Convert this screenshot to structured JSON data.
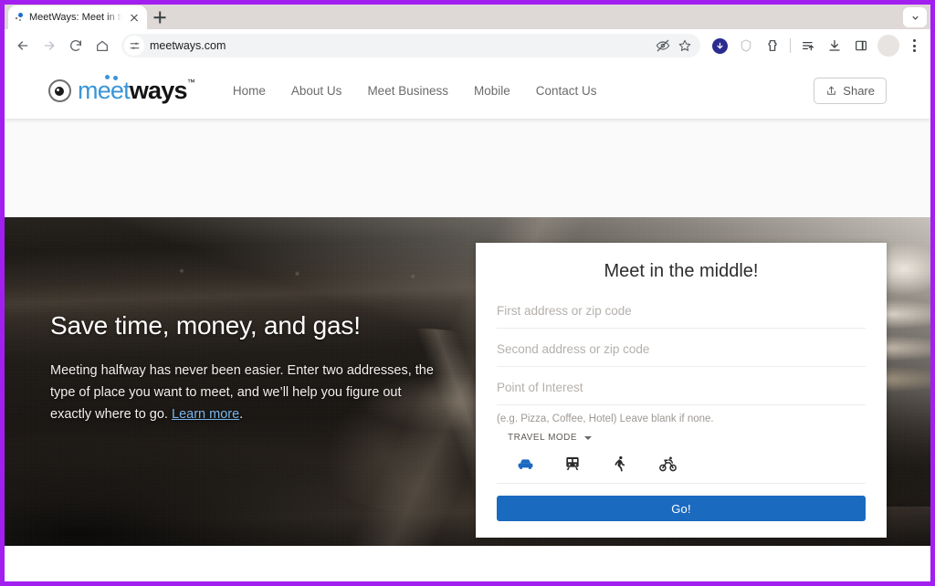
{
  "browser": {
    "tab": {
      "title": "MeetWays: Meet in the Midd",
      "favicon": "meetways-favicon-icon",
      "close": "close-icon"
    },
    "new_tab_label": "new-tab-icon",
    "tabstrip_chevron": "chevron-down-icon",
    "toolbar": {
      "back": "back-arrow-icon",
      "forward": "forward-arrow-icon",
      "reload": "reload-icon",
      "home": "home-icon",
      "site_settings": "tune-sliders-icon",
      "url": "meetways.com",
      "tracking_protection": "eye-off-icon",
      "bookmark": "star-icon",
      "download_alert": "download-notification-badge-icon",
      "shield": "shield-icon",
      "extensions": "extensions-puzzle-icon",
      "reading_list": "reading-list-icon",
      "downloads": "download-icon",
      "side_panel": "side-panel-icon",
      "profile": "avatar",
      "menu": "three-dots-menu-icon"
    }
  },
  "site": {
    "logo": {
      "part_one": "meet",
      "part_two": "ways",
      "trademark": "™"
    },
    "nav": [
      {
        "label": "Home"
      },
      {
        "label": "About Us"
      },
      {
        "label": "Meet Business"
      },
      {
        "label": "Mobile"
      },
      {
        "label": "Contact Us"
      }
    ],
    "share": {
      "label": "Share",
      "icon": "share-upload-icon"
    }
  },
  "hero": {
    "heading": "Save time, money, and gas!",
    "body_before": "Meeting halfway has never been easier. Enter two addresses, the type of place you want to meet, and we’ll help you figure out exactly where to go. ",
    "link_text": "Learn more",
    "body_after": "."
  },
  "form": {
    "title": "Meet in the middle!",
    "first_address": {
      "value": "",
      "placeholder": "First address or zip code"
    },
    "second_address": {
      "value": "",
      "placeholder": "Second address or zip code"
    },
    "point_of_interest": {
      "value": "",
      "placeholder": "Point of Interest"
    },
    "helper_text": "(e.g. Pizza, Coffee, Hotel) Leave blank if none.",
    "travel_mode_label": "TRAVEL MODE",
    "travel_modes": [
      {
        "name": "car",
        "selected": true
      },
      {
        "name": "transit",
        "selected": false
      },
      {
        "name": "walking",
        "selected": false
      },
      {
        "name": "bicycling",
        "selected": false
      }
    ],
    "submit_label": "Go!"
  },
  "colors": {
    "accent_blue": "#1a6ac0",
    "logo_blue": "#3a95d8",
    "link_blue": "#79b6ec",
    "screenshot_border": "#a21ff0",
    "page_bg": "#fafafa"
  }
}
